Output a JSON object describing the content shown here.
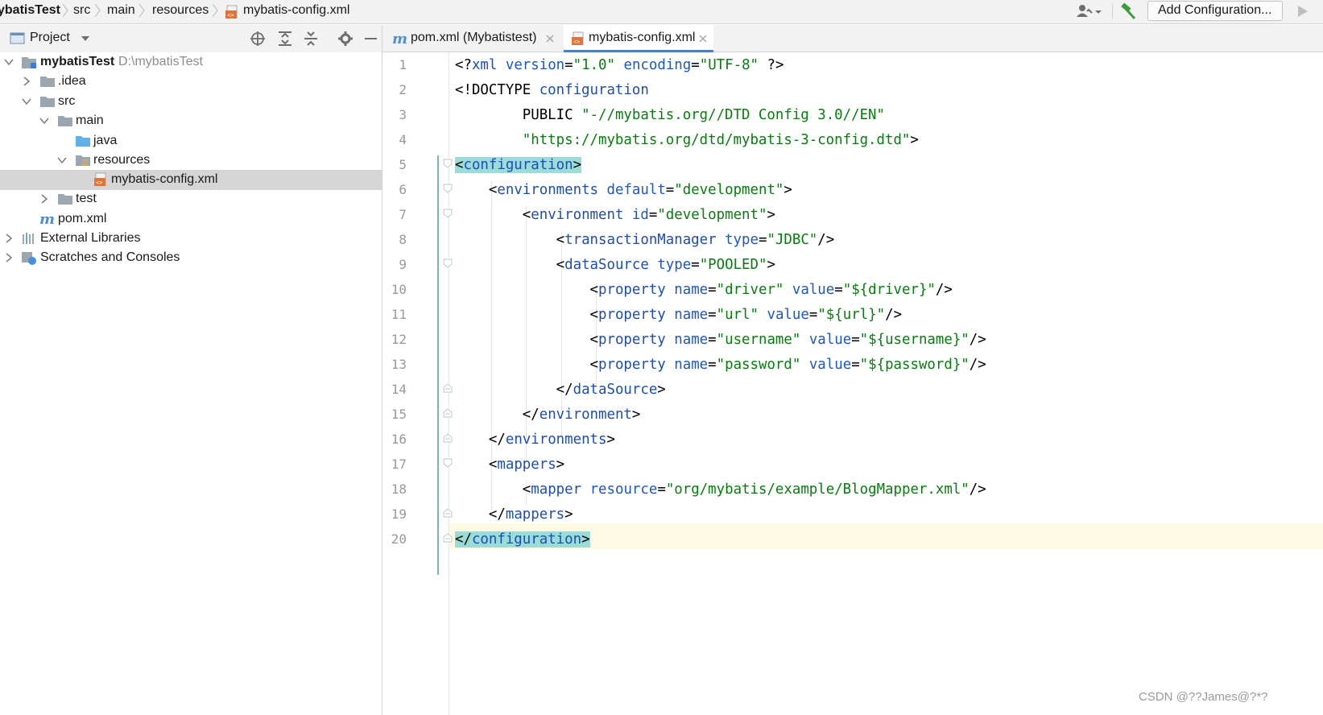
{
  "breadcrumb": {
    "items": [
      "ybatisTest",
      "src",
      "main",
      "resources",
      "mybatis-config.xml"
    ]
  },
  "toolbar": {
    "run_config_label": "Add Configuration...",
    "icons": [
      "user-icon",
      "build-hammer-icon",
      "run-icon"
    ]
  },
  "project_panel": {
    "title": "Project",
    "tools": [
      "locate-icon",
      "expand-all-icon",
      "collapse-all-icon",
      "gear-icon",
      "minimize-icon"
    ],
    "tree": [
      {
        "label": "mybatisTest",
        "path": "D:\\mybatisTest",
        "bold": true,
        "expanded": true,
        "icon": "module-folder-icon"
      },
      {
        "label": ".idea",
        "expanded": false,
        "icon": "folder-icon"
      },
      {
        "label": "src",
        "expanded": true,
        "icon": "folder-icon"
      },
      {
        "label": "main",
        "expanded": true,
        "icon": "folder-icon"
      },
      {
        "label": "java",
        "icon": "source-folder-icon"
      },
      {
        "label": "resources",
        "expanded": true,
        "icon": "resources-folder-icon"
      },
      {
        "label": "mybatis-config.xml",
        "icon": "xml-file-icon",
        "selected": true
      },
      {
        "label": "test",
        "expanded": false,
        "icon": "folder-icon"
      },
      {
        "label": "pom.xml",
        "icon": "maven-icon"
      },
      {
        "label": "External Libraries",
        "expanded": false,
        "icon": "libraries-icon"
      },
      {
        "label": "Scratches and Consoles",
        "expanded": false,
        "icon": "scratches-icon"
      }
    ]
  },
  "tabs": [
    {
      "label": "pom.xml (Mybatistest)",
      "icon": "maven-icon",
      "active": false
    },
    {
      "label": "mybatis-config.xml",
      "icon": "xml-file-icon",
      "active": true
    }
  ],
  "editor": {
    "line_numbers": [
      "1",
      "2",
      "3",
      "4",
      "5",
      "6",
      "7",
      "8",
      "9",
      "10",
      "11",
      "12",
      "13",
      "14",
      "15",
      "16",
      "17",
      "18",
      "19",
      "20"
    ],
    "current_line": 20,
    "lines": [
      "<?xml version=\"1.0\" encoding=\"UTF-8\" ?>",
      "<!DOCTYPE configuration",
      "        PUBLIC \"-//mybatis.org//DTD Config 3.0//EN\"",
      "        \"https://mybatis.org/dtd/mybatis-3-config.dtd\">",
      "<configuration>",
      "    <environments default=\"development\">",
      "        <environment id=\"development\">",
      "            <transactionManager type=\"JDBC\"/>",
      "            <dataSource type=\"POOLED\">",
      "                <property name=\"driver\" value=\"${driver}\"/>",
      "                <property name=\"url\" value=\"${url}\"/>",
      "                <property name=\"username\" value=\"${username}\"/>",
      "                <property name=\"password\" value=\"${password}\"/>",
      "            </dataSource>",
      "        </environment>",
      "    </environments>",
      "    <mappers>",
      "        <mapper resource=\"org/mybatis/example/BlogMapper.xml\"/>",
      "    </mappers>",
      "</configuration>"
    ]
  },
  "watermark": "CSDN @??James@?*?",
  "colors": {
    "tag": "#1e4db3",
    "attribute": "#1d57c2",
    "string": "#077d0e",
    "tab_underline": "#4083c9",
    "selection": "#d5d5d5",
    "tag_match_highlight": "#99dcd8",
    "current_line": "#fcfae3"
  }
}
